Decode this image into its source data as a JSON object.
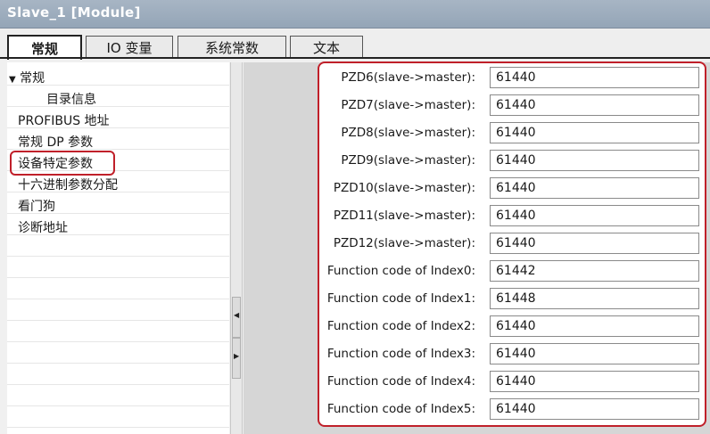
{
  "window": {
    "title": "Slave_1 [Module]"
  },
  "tabs": [
    {
      "label": "常规",
      "active": true
    },
    {
      "label": "IO 变量",
      "active": false
    },
    {
      "label": "系统常数",
      "active": false
    },
    {
      "label": "文本",
      "active": false
    }
  ],
  "nav": {
    "group_label": "常规",
    "group_arrow": "▼",
    "items": [
      "目录信息",
      "PROFIBUS 地址",
      "常规 DP 参数",
      "设备特定参数",
      "十六进制参数分配",
      "看门狗",
      "诊断地址"
    ],
    "selected": "设备特定参数"
  },
  "params": [
    {
      "label": "PZD6(slave->master):",
      "value": "61440"
    },
    {
      "label": "PZD7(slave->master):",
      "value": "61440"
    },
    {
      "label": "PZD8(slave->master):",
      "value": "61440"
    },
    {
      "label": "PZD9(slave->master):",
      "value": "61440"
    },
    {
      "label": "PZD10(slave->master):",
      "value": "61440"
    },
    {
      "label": "PZD11(slave->master):",
      "value": "61440"
    },
    {
      "label": "PZD12(slave->master):",
      "value": "61440"
    },
    {
      "label": "Function code of Index0:",
      "value": "61442"
    },
    {
      "label": "Function code of Index1:",
      "value": "61448"
    },
    {
      "label": "Function code of Index2:",
      "value": "61440"
    },
    {
      "label": "Function code of Index3:",
      "value": "61440"
    },
    {
      "label": "Function code of Index4:",
      "value": "61440"
    },
    {
      "label": "Function code of Index5:",
      "value": "61440"
    }
  ],
  "colors": {
    "highlight": "#c0202a",
    "titlebar": "#9fb0c2"
  }
}
